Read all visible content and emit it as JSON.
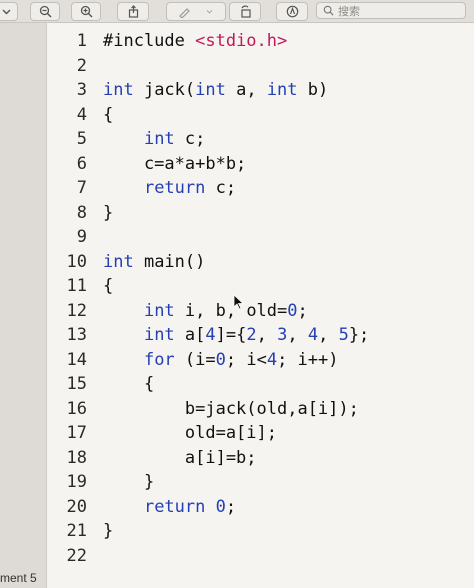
{
  "toolbar": {
    "search_placeholder": "搜索",
    "buttons": [
      "chevron-down",
      "zoom-out",
      "zoom-in",
      "share",
      "highlight",
      "rotate",
      "markup",
      "search"
    ]
  },
  "editor": {
    "lines": [
      {
        "n": "1",
        "tokens": [
          [
            "#include ",
            ""
          ],
          [
            "<stdio.h>",
            "str"
          ]
        ]
      },
      {
        "n": "2",
        "tokens": []
      },
      {
        "n": "3",
        "tokens": [
          [
            "int",
            "kw"
          ],
          [
            " jack(",
            ""
          ],
          [
            "int",
            "kw"
          ],
          [
            " a, ",
            ""
          ],
          [
            "int",
            "kw"
          ],
          [
            " b)",
            ""
          ]
        ]
      },
      {
        "n": "4",
        "tokens": [
          [
            "{",
            ""
          ]
        ]
      },
      {
        "n": "5",
        "tokens": [
          [
            "    ",
            ""
          ],
          [
            "int",
            "kw"
          ],
          [
            " c;",
            ""
          ]
        ]
      },
      {
        "n": "6",
        "tokens": [
          [
            "    c=a*a+b*b;",
            ""
          ]
        ]
      },
      {
        "n": "7",
        "tokens": [
          [
            "    ",
            ""
          ],
          [
            "return",
            "kw"
          ],
          [
            " c;",
            ""
          ]
        ]
      },
      {
        "n": "8",
        "tokens": [
          [
            "}",
            ""
          ]
        ]
      },
      {
        "n": "9",
        "tokens": []
      },
      {
        "n": "10",
        "tokens": [
          [
            "int",
            "kw"
          ],
          [
            " main()",
            ""
          ]
        ]
      },
      {
        "n": "11",
        "tokens": [
          [
            "{",
            ""
          ]
        ]
      },
      {
        "n": "12",
        "tokens": [
          [
            "    ",
            ""
          ],
          [
            "int",
            "kw"
          ],
          [
            " i, b, old=",
            ""
          ],
          [
            "0",
            "num"
          ],
          [
            ";",
            ""
          ]
        ]
      },
      {
        "n": "13",
        "tokens": [
          [
            "    ",
            ""
          ],
          [
            "int",
            "kw"
          ],
          [
            " a[",
            ""
          ],
          [
            "4",
            "num"
          ],
          [
            "]={",
            ""
          ],
          [
            "2",
            "num"
          ],
          [
            ", ",
            ""
          ],
          [
            "3",
            "num"
          ],
          [
            ", ",
            ""
          ],
          [
            "4",
            "num"
          ],
          [
            ", ",
            ""
          ],
          [
            "5",
            "num"
          ],
          [
            "};",
            ""
          ]
        ]
      },
      {
        "n": "14",
        "tokens": [
          [
            "    ",
            ""
          ],
          [
            "for",
            "kw"
          ],
          [
            " (i=",
            ""
          ],
          [
            "0",
            "num"
          ],
          [
            "; i<",
            ""
          ],
          [
            "4",
            "num"
          ],
          [
            "; i++)",
            ""
          ]
        ]
      },
      {
        "n": "15",
        "tokens": [
          [
            "    {",
            ""
          ]
        ]
      },
      {
        "n": "16",
        "tokens": [
          [
            "        b=jack(old,a[i]);",
            ""
          ]
        ]
      },
      {
        "n": "17",
        "tokens": [
          [
            "        old=a[i];",
            ""
          ]
        ]
      },
      {
        "n": "18",
        "tokens": [
          [
            "        a[i]=b;",
            ""
          ]
        ]
      },
      {
        "n": "19",
        "tokens": [
          [
            "    }",
            ""
          ]
        ]
      },
      {
        "n": "20",
        "tokens": [
          [
            "    ",
            ""
          ],
          [
            "return",
            "kw"
          ],
          [
            " ",
            ""
          ],
          [
            "0",
            "num"
          ],
          [
            ";",
            ""
          ]
        ]
      },
      {
        "n": "21",
        "tokens": [
          [
            "}",
            ""
          ]
        ]
      },
      {
        "n": "22",
        "tokens": []
      }
    ]
  },
  "status": {
    "text": "ment 5"
  },
  "colors": {
    "keyword": "#2440b3",
    "string": "#c2185b",
    "number": "#2440b3"
  }
}
